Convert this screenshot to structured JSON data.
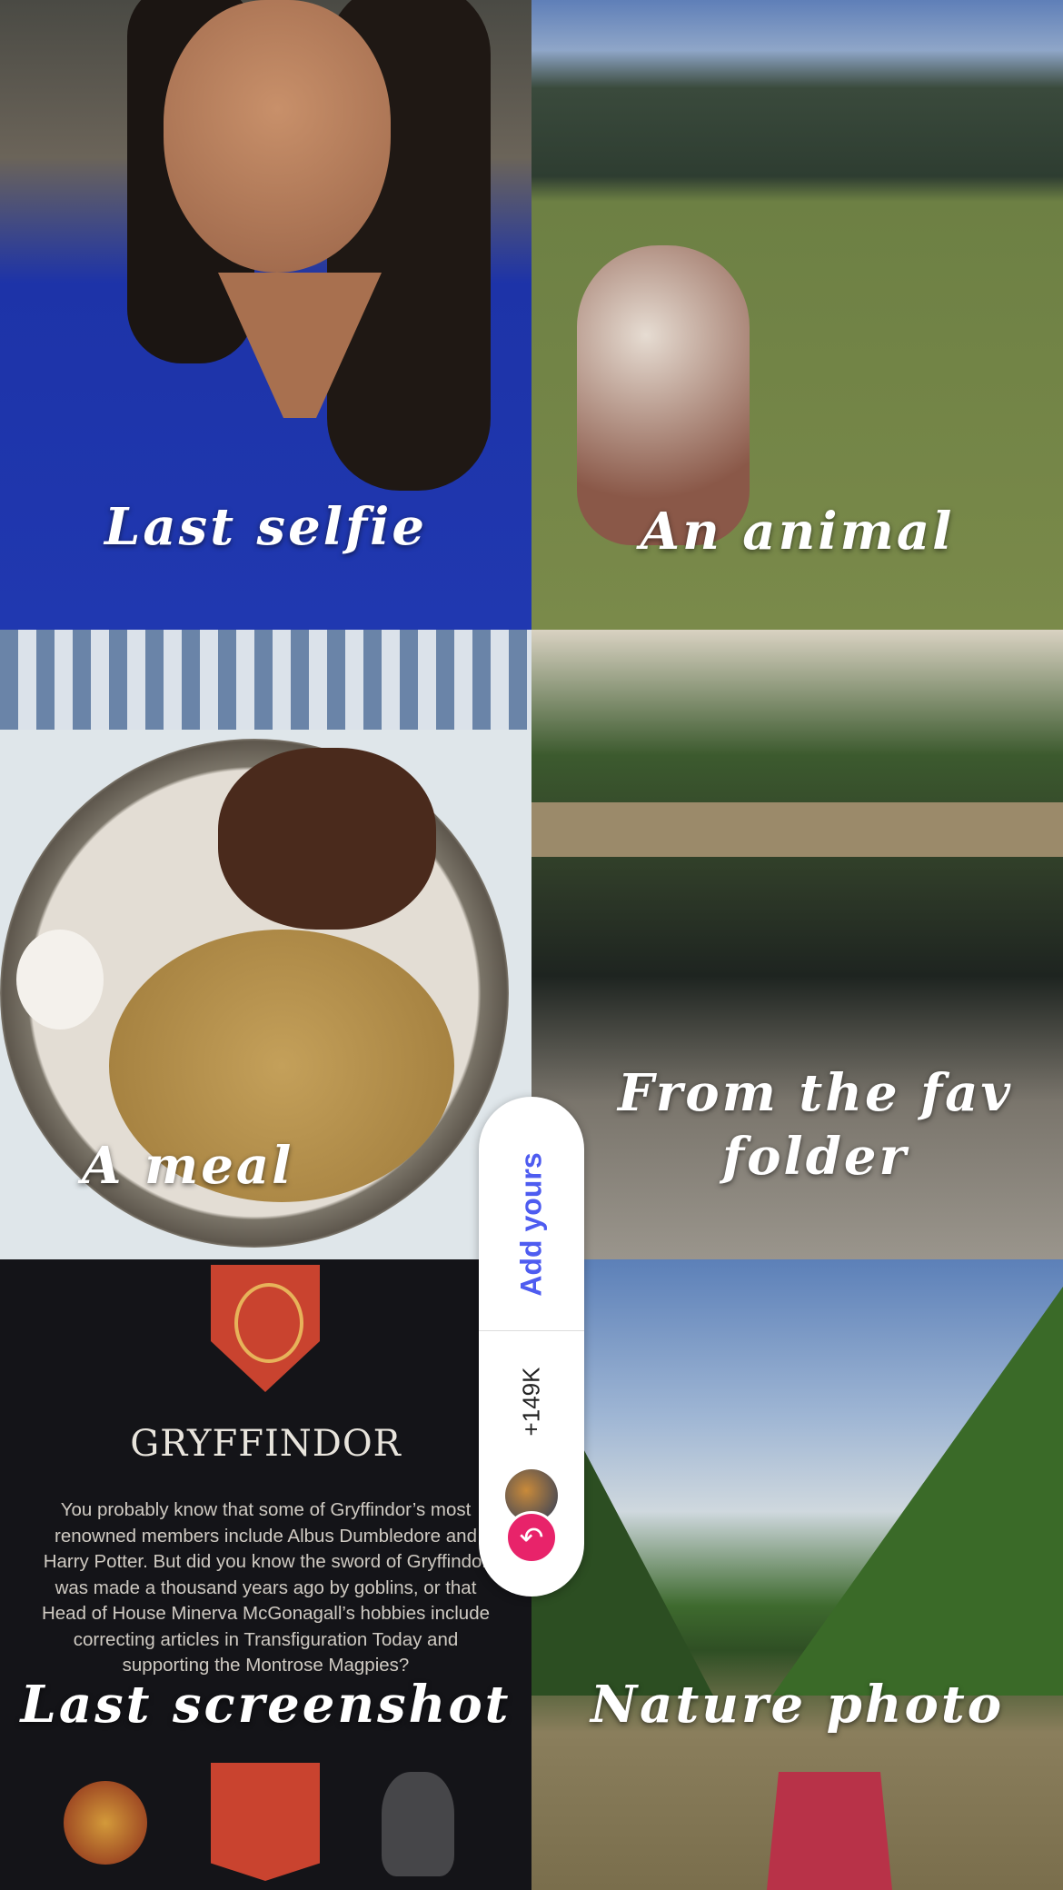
{
  "tiles": [
    {
      "caption": "Last selfie"
    },
    {
      "caption": "An animal"
    },
    {
      "caption": "A meal"
    },
    {
      "caption": "From the fav folder"
    },
    {
      "caption": "Last screenshot",
      "screenshot": {
        "house_name": "GRYFFINDOR",
        "paragraph": "You probably know that some of Gryffindor’s most renowned members include Albus Dumbledore and Harry Potter. But did you know the sword of Gryffindor was made a thousand years ago by goblins, or that Head of House Minerva McGonagall’s hobbies include correcting articles in Transfiguration Today and supporting the Montrose Magpies?"
      }
    },
    {
      "caption": "Nature photo"
    }
  ],
  "sticker": {
    "add_label": "Add yours",
    "count": "+149K",
    "accent_color": "#4e5cf0",
    "reply_icon": "reply-arrow-icon"
  }
}
